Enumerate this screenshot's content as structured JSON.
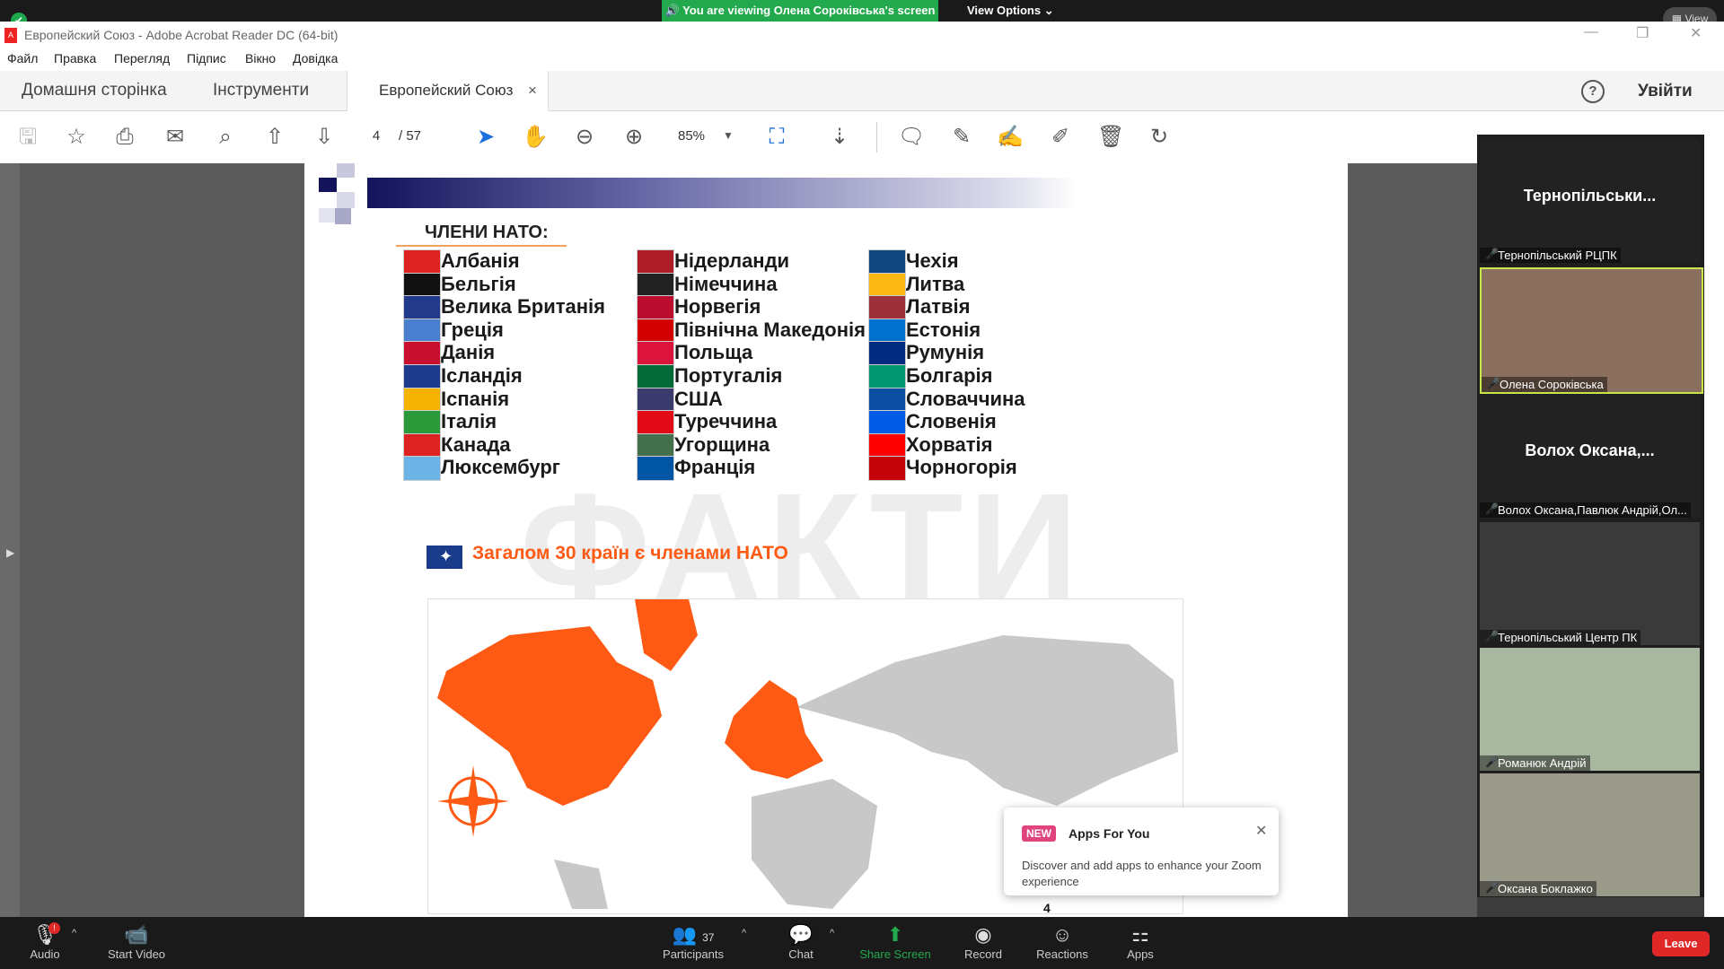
{
  "zoom_top": {
    "share_banner": "You are viewing Олена Сороківська's screen",
    "view_options": "View Options ⌄",
    "view_label": "View"
  },
  "acrobat": {
    "title": "Европейский Союз - Adobe Acrobat Reader DC (64-bit)",
    "menu": [
      "Файл",
      "Правка",
      "Перегляд",
      "Підпис",
      "Вікно",
      "Довідка"
    ],
    "tabs": {
      "home": "Домашня сторінка",
      "tools": "Інструменти",
      "document": "Европейский Союз",
      "close": "×"
    },
    "login": "Увійти",
    "help": "?",
    "page_current": "4",
    "page_total": "/  57",
    "zoom": "85%"
  },
  "document": {
    "heading": "ЧЛЕНИ НАТО:",
    "countries_col1": [
      "Албанія",
      "Бельгія",
      "Велика Британія",
      "Греція",
      "Данія",
      "Ісландія",
      "Іспанія",
      "Італія",
      "Канада",
      "Люксембург"
    ],
    "countries_col2": [
      "Нідерланди",
      "Німеччина",
      "Норвегія",
      "Північна Македонія",
      "Польща",
      "Португалія",
      "США",
      "Туреччина",
      "Угорщина",
      "Франція"
    ],
    "countries_col3": [
      "Чехія",
      "Литва",
      "Латвія",
      "Естонія",
      "Румунія",
      "Болгарія",
      "Словаччина",
      "Словенія",
      "Хорватія",
      "Чорногорія"
    ],
    "total": "Загалом 30 країн є членами НАТО",
    "watermark": "ФАКТИ",
    "page_marker": "4"
  },
  "gallery": {
    "tiles": [
      {
        "big": "Тернопільськи...",
        "name": "Тернопільський РЦПК"
      },
      {
        "big": "",
        "name": "Олена Сороківська"
      },
      {
        "big": "Волох  Оксана,...",
        "name": "Волох Оксана,Павлюк Андрій,Ол..."
      },
      {
        "big": "",
        "name": "Тернопільський Центр ПК"
      },
      {
        "big": "",
        "name": "Романюк Андрій"
      },
      {
        "big": "",
        "name": "Оксана Боклажко"
      }
    ]
  },
  "apps_popup": {
    "badge": "NEW",
    "title": "Apps For You",
    "description": "Discover and add apps to enhance your Zoom experience",
    "close": "✕"
  },
  "bottom_bar": {
    "audio": "Audio",
    "video": "Start Video",
    "participants": "Participants",
    "participants_count": "37",
    "chat": "Chat",
    "share": "Share Screen",
    "record": "Record",
    "reactions": "Reactions",
    "apps": "Apps",
    "leave": "Leave",
    "audio_badge": "!"
  },
  "colors": {
    "zoom_green": "#23a94d",
    "nato_orange": "#ff5a14",
    "leave_red": "#e02828"
  }
}
